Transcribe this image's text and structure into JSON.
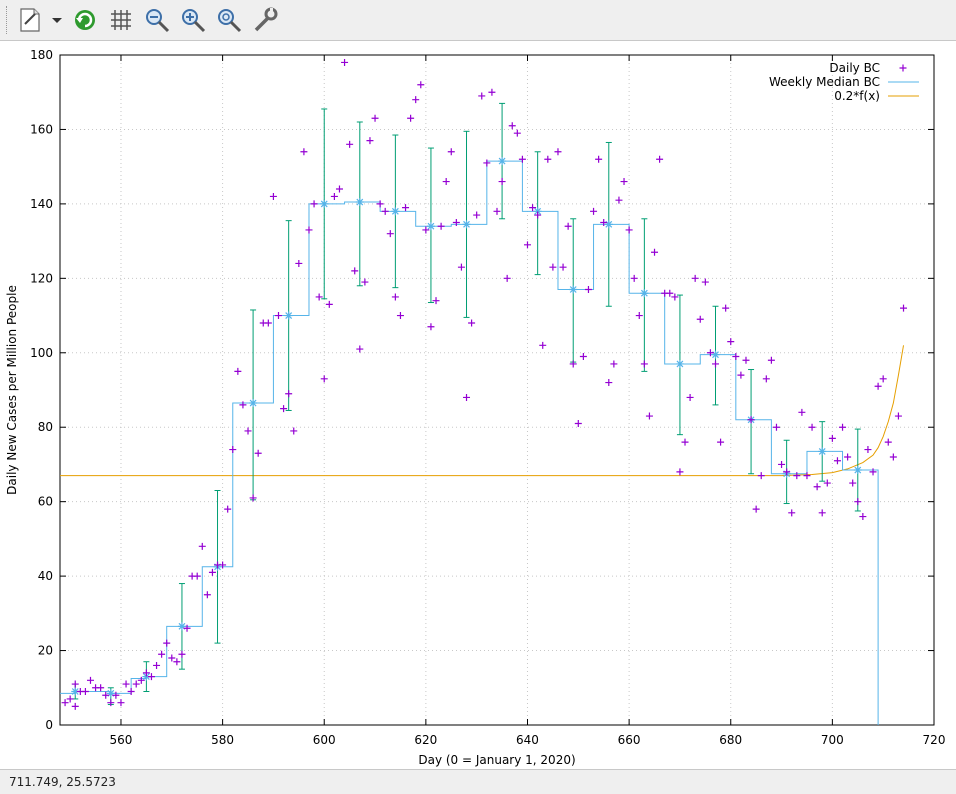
{
  "toolbar": {
    "buttons": [
      {
        "name": "export-icon"
      },
      {
        "name": "dropdown-icon"
      },
      {
        "name": "replot-icon"
      },
      {
        "name": "grid-icon"
      },
      {
        "name": "zoom-out-icon"
      },
      {
        "name": "zoom-in-icon"
      },
      {
        "name": "zoom-reset-icon"
      },
      {
        "name": "settings-icon"
      }
    ]
  },
  "status": {
    "coords": "711.749,  25.5723"
  },
  "chart_data": {
    "type": "scatter",
    "xlabel": "Day (0 = January 1, 2020)",
    "ylabel": "Daily New Cases per Million People",
    "xlim": [
      548,
      720
    ],
    "ylim": [
      0,
      180
    ],
    "xticks": [
      560,
      580,
      600,
      620,
      640,
      660,
      680,
      700,
      720
    ],
    "yticks": [
      0,
      20,
      40,
      60,
      80,
      100,
      120,
      140,
      160,
      180
    ],
    "grid": true,
    "legend_position": "top-right",
    "colors": {
      "daily": "#9400d3",
      "median": "#56b4e9",
      "errorbar": "#009e73",
      "fit": "#e69f00"
    },
    "series": [
      {
        "name": "Daily BC",
        "style": "points",
        "points": [
          [
            549,
            6
          ],
          [
            550,
            7
          ],
          [
            551,
            5
          ],
          [
            551,
            11
          ],
          [
            552,
            9
          ],
          [
            553,
            9
          ],
          [
            554,
            12
          ],
          [
            555,
            10
          ],
          [
            556,
            10
          ],
          [
            557,
            8
          ],
          [
            558,
            6
          ],
          [
            559,
            8
          ],
          [
            560,
            6
          ],
          [
            561,
            11
          ],
          [
            562,
            9
          ],
          [
            563,
            11
          ],
          [
            564,
            12
          ],
          [
            565,
            14
          ],
          [
            566,
            13
          ],
          [
            567,
            16
          ],
          [
            568,
            19
          ],
          [
            569,
            22
          ],
          [
            570,
            18
          ],
          [
            571,
            17
          ],
          [
            572,
            19
          ],
          [
            573,
            26
          ],
          [
            574,
            40
          ],
          [
            575,
            40
          ],
          [
            576,
            48
          ],
          [
            577,
            35
          ],
          [
            578,
            41
          ],
          [
            579,
            43
          ],
          [
            580,
            43
          ],
          [
            581,
            58
          ],
          [
            582,
            74
          ],
          [
            583,
            95
          ],
          [
            584,
            86
          ],
          [
            585,
            79
          ],
          [
            586,
            61
          ],
          [
            587,
            73
          ],
          [
            588,
            108
          ],
          [
            589,
            108
          ],
          [
            590,
            142
          ],
          [
            591,
            110
          ],
          [
            592,
            85
          ],
          [
            593,
            89
          ],
          [
            594,
            79
          ],
          [
            595,
            124
          ],
          [
            596,
            154
          ],
          [
            597,
            133
          ],
          [
            598,
            140
          ],
          [
            599,
            115
          ],
          [
            600,
            93
          ],
          [
            601,
            113
          ],
          [
            602,
            142
          ],
          [
            603,
            144
          ],
          [
            604,
            178
          ],
          [
            605,
            156
          ],
          [
            606,
            122
          ],
          [
            607,
            101
          ],
          [
            608,
            119
          ],
          [
            609,
            157
          ],
          [
            610,
            163
          ],
          [
            611,
            140
          ],
          [
            612,
            138
          ],
          [
            613,
            132
          ],
          [
            614,
            115
          ],
          [
            615,
            110
          ],
          [
            616,
            139
          ],
          [
            617,
            163
          ],
          [
            618,
            168
          ],
          [
            619,
            172
          ],
          [
            620,
            133
          ],
          [
            621,
            107
          ],
          [
            622,
            114
          ],
          [
            623,
            134
          ],
          [
            624,
            146
          ],
          [
            625,
            154
          ],
          [
            626,
            135
          ],
          [
            627,
            123
          ],
          [
            628,
            88
          ],
          [
            629,
            108
          ],
          [
            630,
            137
          ],
          [
            631,
            169
          ],
          [
            632,
            151
          ],
          [
            633,
            170
          ],
          [
            634,
            138
          ],
          [
            635,
            146
          ],
          [
            636,
            120
          ],
          [
            637,
            161
          ],
          [
            638,
            159
          ],
          [
            639,
            152
          ],
          [
            640,
            129
          ],
          [
            641,
            139
          ],
          [
            642,
            137
          ],
          [
            643,
            102
          ],
          [
            644,
            152
          ],
          [
            645,
            123
          ],
          [
            646,
            154
          ],
          [
            647,
            123
          ],
          [
            648,
            134
          ],
          [
            649,
            97
          ],
          [
            650,
            81
          ],
          [
            651,
            99
          ],
          [
            652,
            117
          ],
          [
            653,
            138
          ],
          [
            654,
            152
          ],
          [
            655,
            135
          ],
          [
            656,
            92
          ],
          [
            657,
            97
          ],
          [
            658,
            141
          ],
          [
            659,
            146
          ],
          [
            660,
            133
          ],
          [
            661,
            120
          ],
          [
            662,
            110
          ],
          [
            663,
            97
          ],
          [
            664,
            83
          ],
          [
            665,
            127
          ],
          [
            666,
            152
          ],
          [
            667,
            116
          ],
          [
            668,
            116
          ],
          [
            669,
            115
          ],
          [
            670,
            68
          ],
          [
            671,
            76
          ],
          [
            672,
            88
          ],
          [
            673,
            120
          ],
          [
            674,
            109
          ],
          [
            675,
            119
          ],
          [
            676,
            100
          ],
          [
            677,
            97
          ],
          [
            678,
            76
          ],
          [
            679,
            112
          ],
          [
            680,
            103
          ],
          [
            681,
            99
          ],
          [
            682,
            94
          ],
          [
            683,
            98
          ],
          [
            684,
            82
          ],
          [
            685,
            58
          ],
          [
            686,
            67
          ],
          [
            687,
            93
          ],
          [
            688,
            98
          ],
          [
            689,
            80
          ],
          [
            690,
            70
          ],
          [
            691,
            68
          ],
          [
            692,
            57
          ],
          [
            693,
            67
          ],
          [
            694,
            84
          ],
          [
            695,
            67
          ],
          [
            696,
            80
          ],
          [
            697,
            64
          ],
          [
            698,
            57
          ],
          [
            699,
            65
          ],
          [
            700,
            77
          ],
          [
            701,
            71
          ],
          [
            702,
            80
          ],
          [
            703,
            72
          ],
          [
            704,
            65
          ],
          [
            705,
            60
          ],
          [
            706,
            56
          ],
          [
            707,
            74
          ],
          [
            708,
            68
          ],
          [
            709,
            91
          ],
          [
            710,
            93
          ],
          [
            711,
            76
          ],
          [
            712,
            72
          ],
          [
            713,
            83
          ],
          [
            714,
            112
          ]
        ]
      },
      {
        "name": "Weekly Median BC",
        "style": "steps",
        "steps": [
          [
            548,
            8.5
          ],
          [
            551,
            8.5
          ],
          [
            551,
            9
          ],
          [
            558,
            9
          ],
          [
            558,
            8.5
          ],
          [
            562,
            8.5
          ],
          [
            562,
            12.5
          ],
          [
            565,
            12.5
          ],
          [
            565,
            13
          ],
          [
            569,
            13
          ],
          [
            569,
            26.5
          ],
          [
            576,
            26.5
          ],
          [
            576,
            42.5
          ],
          [
            582,
            42.5
          ],
          [
            582,
            86.5
          ],
          [
            590,
            86.5
          ],
          [
            590,
            110
          ],
          [
            597,
            110
          ],
          [
            597,
            140
          ],
          [
            604,
            140
          ],
          [
            604,
            140.5
          ],
          [
            611,
            140.5
          ],
          [
            611,
            138
          ],
          [
            618,
            138
          ],
          [
            618,
            134
          ],
          [
            625,
            134
          ],
          [
            625,
            134.5
          ],
          [
            632,
            134.5
          ],
          [
            632,
            151.5
          ],
          [
            639,
            151.5
          ],
          [
            639,
            138
          ],
          [
            646,
            138
          ],
          [
            646,
            117
          ],
          [
            653,
            117
          ],
          [
            653,
            134.5
          ],
          [
            660,
            134.5
          ],
          [
            660,
            116
          ],
          [
            667,
            116
          ],
          [
            667,
            97
          ],
          [
            674,
            97
          ],
          [
            674,
            99.5
          ],
          [
            681,
            99.5
          ],
          [
            681,
            82
          ],
          [
            688,
            82
          ],
          [
            688,
            67.5
          ],
          [
            695,
            67.5
          ],
          [
            695,
            73.5
          ],
          [
            702,
            73.5
          ],
          [
            702,
            68.5
          ],
          [
            709,
            68.5
          ],
          [
            709,
            0
          ]
        ]
      },
      {
        "name": "0.2*f(x)",
        "style": "line",
        "points": [
          [
            548,
            67
          ],
          [
            690,
            67
          ],
          [
            696,
            67.3
          ],
          [
            700,
            67.8
          ],
          [
            703,
            68.8
          ],
          [
            706,
            70.5
          ],
          [
            708,
            72.5
          ],
          [
            709,
            74.5
          ],
          [
            710,
            77.5
          ],
          [
            711,
            81.5
          ],
          [
            712,
            86.5
          ],
          [
            713,
            94
          ],
          [
            714,
            102
          ]
        ]
      }
    ],
    "errorbars": [
      {
        "x": 551,
        "y": 9,
        "low": 7,
        "high": 11
      },
      {
        "x": 558,
        "y": 8.5,
        "low": 5.5,
        "high": 10
      },
      {
        "x": 565,
        "y": 13,
        "low": 9,
        "high": 17
      },
      {
        "x": 572,
        "y": 26.5,
        "low": 15,
        "high": 38
      },
      {
        "x": 579,
        "y": 42.5,
        "low": 22,
        "high": 63
      },
      {
        "x": 586,
        "y": 86.5,
        "low": 60.5,
        "high": 111.5
      },
      {
        "x": 593,
        "y": 110,
        "low": 84.5,
        "high": 135.5
      },
      {
        "x": 600,
        "y": 140,
        "low": 114.5,
        "high": 165.5
      },
      {
        "x": 607,
        "y": 140.5,
        "low": 118,
        "high": 162
      },
      {
        "x": 614,
        "y": 138,
        "low": 117.5,
        "high": 158.5
      },
      {
        "x": 621,
        "y": 134,
        "low": 113.5,
        "high": 155
      },
      {
        "x": 628,
        "y": 134.5,
        "low": 109.5,
        "high": 159.5
      },
      {
        "x": 635,
        "y": 151.5,
        "low": 136,
        "high": 167
      },
      {
        "x": 642,
        "y": 138,
        "low": 121,
        "high": 154
      },
      {
        "x": 649,
        "y": 117,
        "low": 97.5,
        "high": 136
      },
      {
        "x": 656,
        "y": 134.5,
        "low": 112.5,
        "high": 156.5
      },
      {
        "x": 663,
        "y": 116,
        "low": 95,
        "high": 136
      },
      {
        "x": 670,
        "y": 97,
        "low": 78,
        "high": 115.5
      },
      {
        "x": 677,
        "y": 99.5,
        "low": 86,
        "high": 112.5
      },
      {
        "x": 684,
        "y": 82,
        "low": 67.5,
        "high": 95.5
      },
      {
        "x": 691,
        "y": 67.5,
        "low": 59.5,
        "high": 76.5
      },
      {
        "x": 698,
        "y": 73.5,
        "low": 65.5,
        "high": 81.5
      },
      {
        "x": 705,
        "y": 68.5,
        "low": 57.5,
        "high": 79.5
      }
    ]
  }
}
